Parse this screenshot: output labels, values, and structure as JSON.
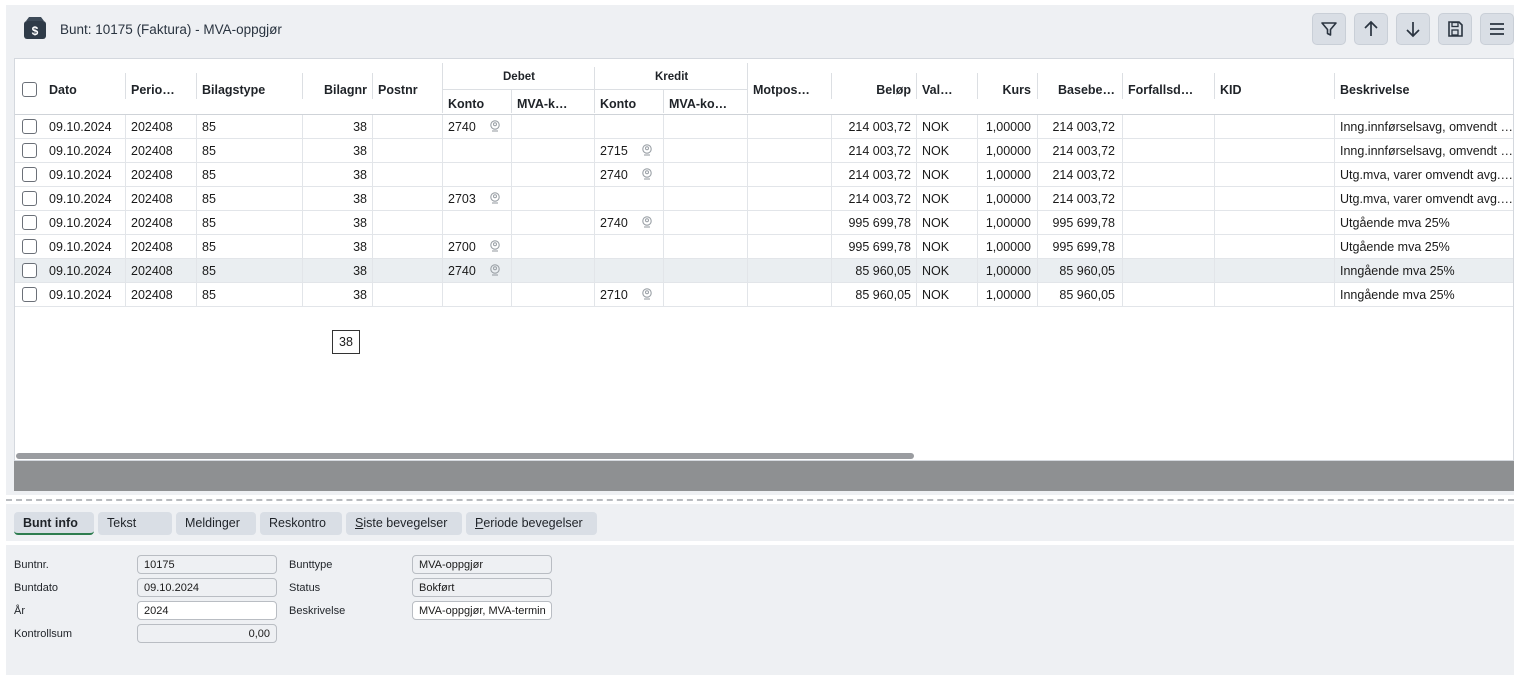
{
  "header": {
    "title": "Bunt: 10175 (Faktura) - MVA-oppgjør",
    "toolbar": [
      {
        "name": "filter-button",
        "icon": "filter-icon"
      },
      {
        "name": "move-up-button",
        "icon": "arrow-up-icon"
      },
      {
        "name": "move-down-button",
        "icon": "arrow-down-icon"
      },
      {
        "name": "save-button",
        "icon": "save-icon"
      },
      {
        "name": "menu-button",
        "icon": "hamburger-menu-icon"
      }
    ]
  },
  "grid": {
    "group_headers": {
      "debet": "Debet",
      "kredit": "Kredit"
    },
    "columns": {
      "dato": "Dato",
      "periode": "Perio…",
      "bilagstype": "Bilagstype",
      "bilagnr": "Bilagnr",
      "postnr": "Postnr",
      "debet_konto": "Konto",
      "debet_mva": "MVA-k…",
      "kredit_konto": "Konto",
      "kredit_mva": "MVA-ko…",
      "motpost": "Motpos…",
      "belop": "Beløp",
      "valuta": "Val…",
      "kurs": "Kurs",
      "basebelop": "Basebe…",
      "forfallsdato": "Forfallsd…",
      "kid": "KID",
      "beskrivelse": "Beskrivelse"
    },
    "rows": [
      {
        "dato": "09.10.2024",
        "periode": "202408",
        "bilagstype": "85",
        "bilagnr": "38",
        "debet_konto": "2740",
        "kredit_konto": "",
        "belop": "214 003,72",
        "valuta": "NOK",
        "kurs": "1,00000",
        "basebelop": "214 003,72",
        "beskrivelse": "Inng.innførselsavg, omvendt …"
      },
      {
        "dato": "09.10.2024",
        "periode": "202408",
        "bilagstype": "85",
        "bilagnr": "38",
        "debet_konto": "",
        "kredit_konto": "2715",
        "belop": "214 003,72",
        "valuta": "NOK",
        "kurs": "1,00000",
        "basebelop": "214 003,72",
        "beskrivelse": "Inng.innførselsavg, omvendt …"
      },
      {
        "dato": "09.10.2024",
        "periode": "202408",
        "bilagstype": "85",
        "bilagnr": "38",
        "debet_konto": "",
        "kredit_konto": "2740",
        "belop": "214 003,72",
        "valuta": "NOK",
        "kurs": "1,00000",
        "basebelop": "214 003,72",
        "beskrivelse": "Utg.mva, varer omvendt avg.…"
      },
      {
        "dato": "09.10.2024",
        "periode": "202408",
        "bilagstype": "85",
        "bilagnr": "38",
        "debet_konto": "2703",
        "kredit_konto": "",
        "belop": "214 003,72",
        "valuta": "NOK",
        "kurs": "1,00000",
        "basebelop": "214 003,72",
        "beskrivelse": "Utg.mva, varer omvendt avg.…"
      },
      {
        "dato": "09.10.2024",
        "periode": "202408",
        "bilagstype": "85",
        "bilagnr": "38",
        "debet_konto": "",
        "kredit_konto": "2740",
        "belop": "995 699,78",
        "valuta": "NOK",
        "kurs": "1,00000",
        "basebelop": "995 699,78",
        "beskrivelse": "Utgående mva 25%"
      },
      {
        "dato": "09.10.2024",
        "periode": "202408",
        "bilagstype": "85",
        "bilagnr": "38",
        "debet_konto": "2700",
        "kredit_konto": "",
        "belop": "995 699,78",
        "valuta": "NOK",
        "kurs": "1,00000",
        "basebelop": "995 699,78",
        "beskrivelse": "Utgående mva 25%"
      },
      {
        "dato": "09.10.2024",
        "periode": "202408",
        "bilagstype": "85",
        "bilagnr": "38",
        "debet_konto": "2740",
        "kredit_konto": "",
        "belop": "85 960,05",
        "valuta": "NOK",
        "kurs": "1,00000",
        "basebelop": "85 960,05",
        "beskrivelse": "Inngående mva 25%"
      },
      {
        "dato": "09.10.2024",
        "periode": "202408",
        "bilagstype": "85",
        "bilagnr": "38",
        "debet_konto": "",
        "kredit_konto": "2710",
        "belop": "85 960,05",
        "valuta": "NOK",
        "kurs": "1,00000",
        "basebelop": "85 960,05",
        "beskrivelse": "Inngående mva 25%"
      }
    ],
    "edit_value": "38"
  },
  "tabs": [
    {
      "label": "Bunt info",
      "active": true
    },
    {
      "label": "Tekst"
    },
    {
      "label": "Meldinger"
    },
    {
      "label": "Reskontro"
    },
    {
      "label": "Siste bevegelser",
      "underline_char": "S"
    },
    {
      "label": "Periode bevegelser",
      "underline_char": "P"
    }
  ],
  "form": {
    "buntnr_label": "Buntnr.",
    "buntnr_value": "10175",
    "buntdato_label": "Buntdato",
    "buntdato_value": "09.10.2024",
    "ar_label": "År",
    "ar_value": "2024",
    "kontrollsum_label": "Kontrollsum",
    "kontrollsum_value": "0,00",
    "bunttype_label": "Bunttype",
    "bunttype_value": "MVA-oppgjør",
    "status_label": "Status",
    "status_value": "Bokført",
    "beskrivelse_label": "Beskrivelse",
    "beskrivelse_value": "MVA-oppgjør, MVA-termin"
  },
  "colors": {
    "panel_bg": "#eef0f3",
    "button_bg": "#d9dee5",
    "active_tab_underline": "#2e7d4f",
    "highlight_row": "#eaeef1"
  }
}
